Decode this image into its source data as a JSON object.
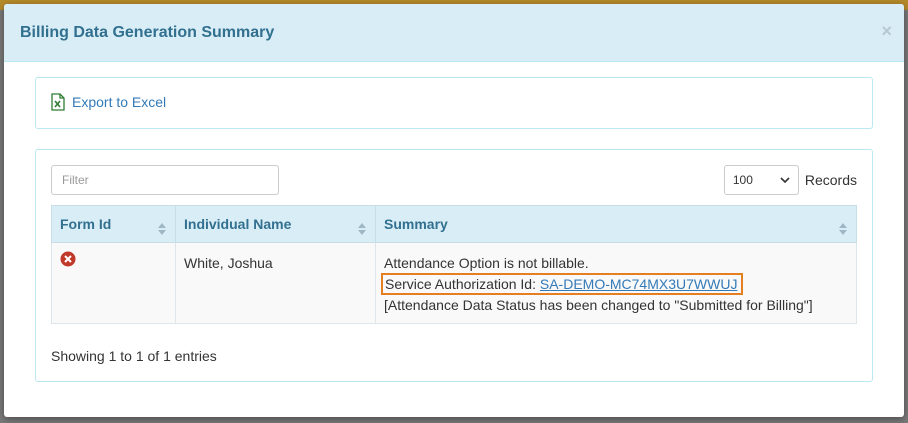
{
  "modal": {
    "title": "Billing Data Generation Summary",
    "close_label": "×"
  },
  "export": {
    "label": "Export to Excel"
  },
  "table_controls": {
    "filter_placeholder": "Filter",
    "page_size": "100",
    "records_label": "Records"
  },
  "table": {
    "columns": [
      "Form Id",
      "Individual Name",
      "Summary"
    ],
    "rows": [
      {
        "status": "error-icon",
        "individual_name": "White, Joshua",
        "summary_line1": "Attendance Option is not billable.",
        "sa_label": "Service Authorization Id: ",
        "sa_id": "SA-DEMO-MC74MX3U7WWUJ",
        "summary_line3": "[Attendance Data Status has been changed to \"Submitted for Billing\"]"
      }
    ]
  },
  "footer": {
    "showing": "Showing 1 to 1 of 1 entries"
  },
  "colors": {
    "header_bg": "#d9edf7",
    "header_text": "#31708f",
    "link": "#337ab7",
    "highlight": "#e67e22",
    "error": "#c0392b"
  }
}
